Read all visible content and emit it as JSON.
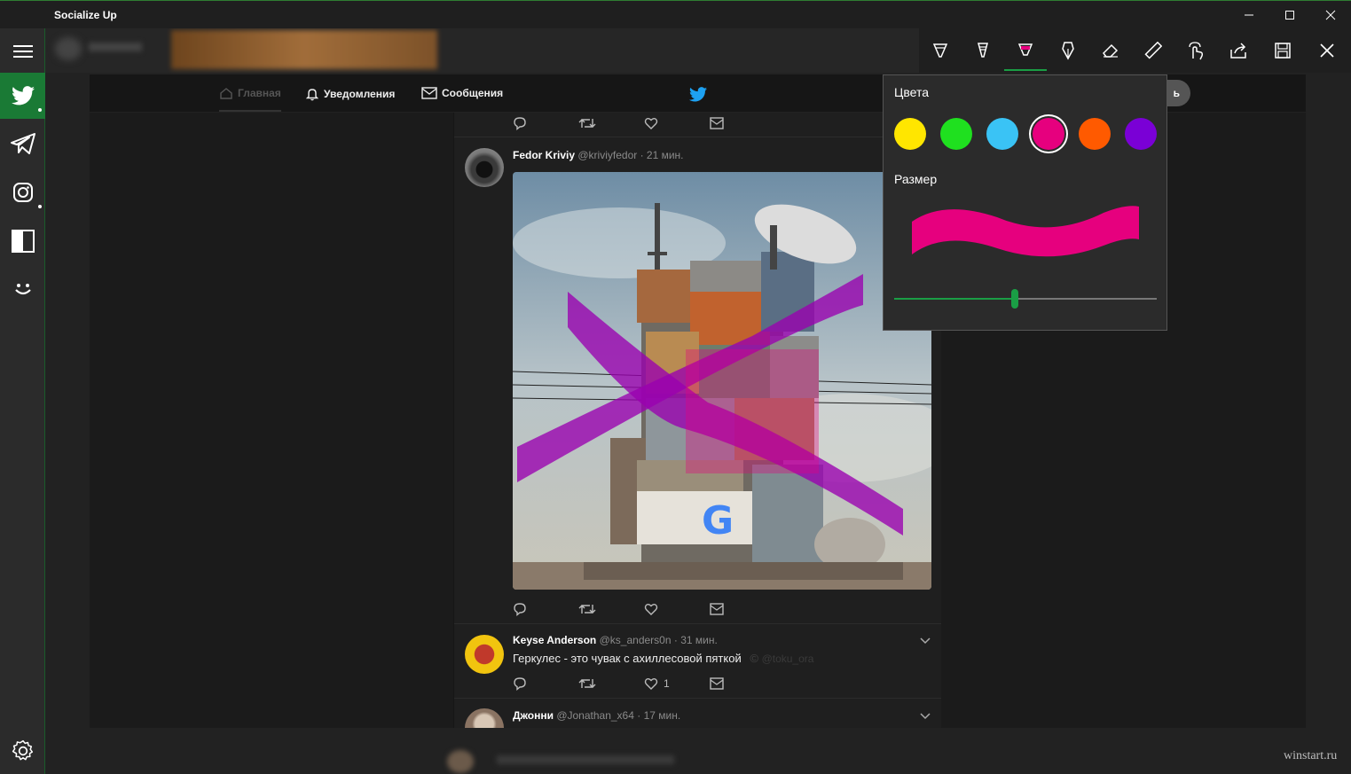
{
  "app": {
    "title": "Socialize Up"
  },
  "window_controls": {
    "minimize": "—",
    "maximize": "☐",
    "close": "✕"
  },
  "sidebar": {
    "items": [
      {
        "name": "menu",
        "icon": "hamburger-icon"
      },
      {
        "name": "twitter",
        "icon": "twitter-icon",
        "active": true,
        "has_dot": true
      },
      {
        "name": "telegram",
        "icon": "telegram-icon"
      },
      {
        "name": "instagram",
        "icon": "instagram-icon",
        "has_dot": true
      },
      {
        "name": "split-view",
        "icon": "split-icon"
      },
      {
        "name": "emoji",
        "icon": "smile-icon"
      },
      {
        "name": "settings",
        "icon": "gear-icon"
      }
    ]
  },
  "ink_toolbar": {
    "tools": [
      "ballpoint-pen-icon",
      "pencil-icon",
      "highlighter-icon",
      "calligraphy-pen-icon",
      "eraser-icon",
      "ruler-icon",
      "touch-writing-icon",
      "share-icon",
      "save-icon",
      "close-icon"
    ],
    "selected_tool": "highlighter-icon"
  },
  "twitter_nav": {
    "home": "Главная",
    "notifications": "Уведомления",
    "messages": "Сообщения",
    "search_partial": "ь"
  },
  "tweets": [
    {
      "name": "Fedor Kriviy",
      "handle": "@kriviyfedor",
      "time": "· 21 мин.",
      "has_image": true
    },
    {
      "name": "Keyse Anderson",
      "handle": "@ks_anders0n",
      "time": "· 31 мин.",
      "text": "Геркулес - это чувак с ахиллесовой пяткой",
      "quote_handle": "@toku_ora",
      "likes": "1"
    },
    {
      "name": "Джонни",
      "handle": "@Jonathan_x64",
      "time": "· 17 мин."
    }
  ],
  "ink_popup": {
    "colors_label": "Цвета",
    "size_label": "Размер",
    "colors": [
      "#ffe600",
      "#1fe01f",
      "#3ac3f5",
      "#e6007e",
      "#ff5a00",
      "#7a00d6"
    ],
    "selected_color": "#e6007e",
    "size_value": 0.46,
    "accent": "#1a9e45"
  },
  "watermark": "winstart.ru"
}
